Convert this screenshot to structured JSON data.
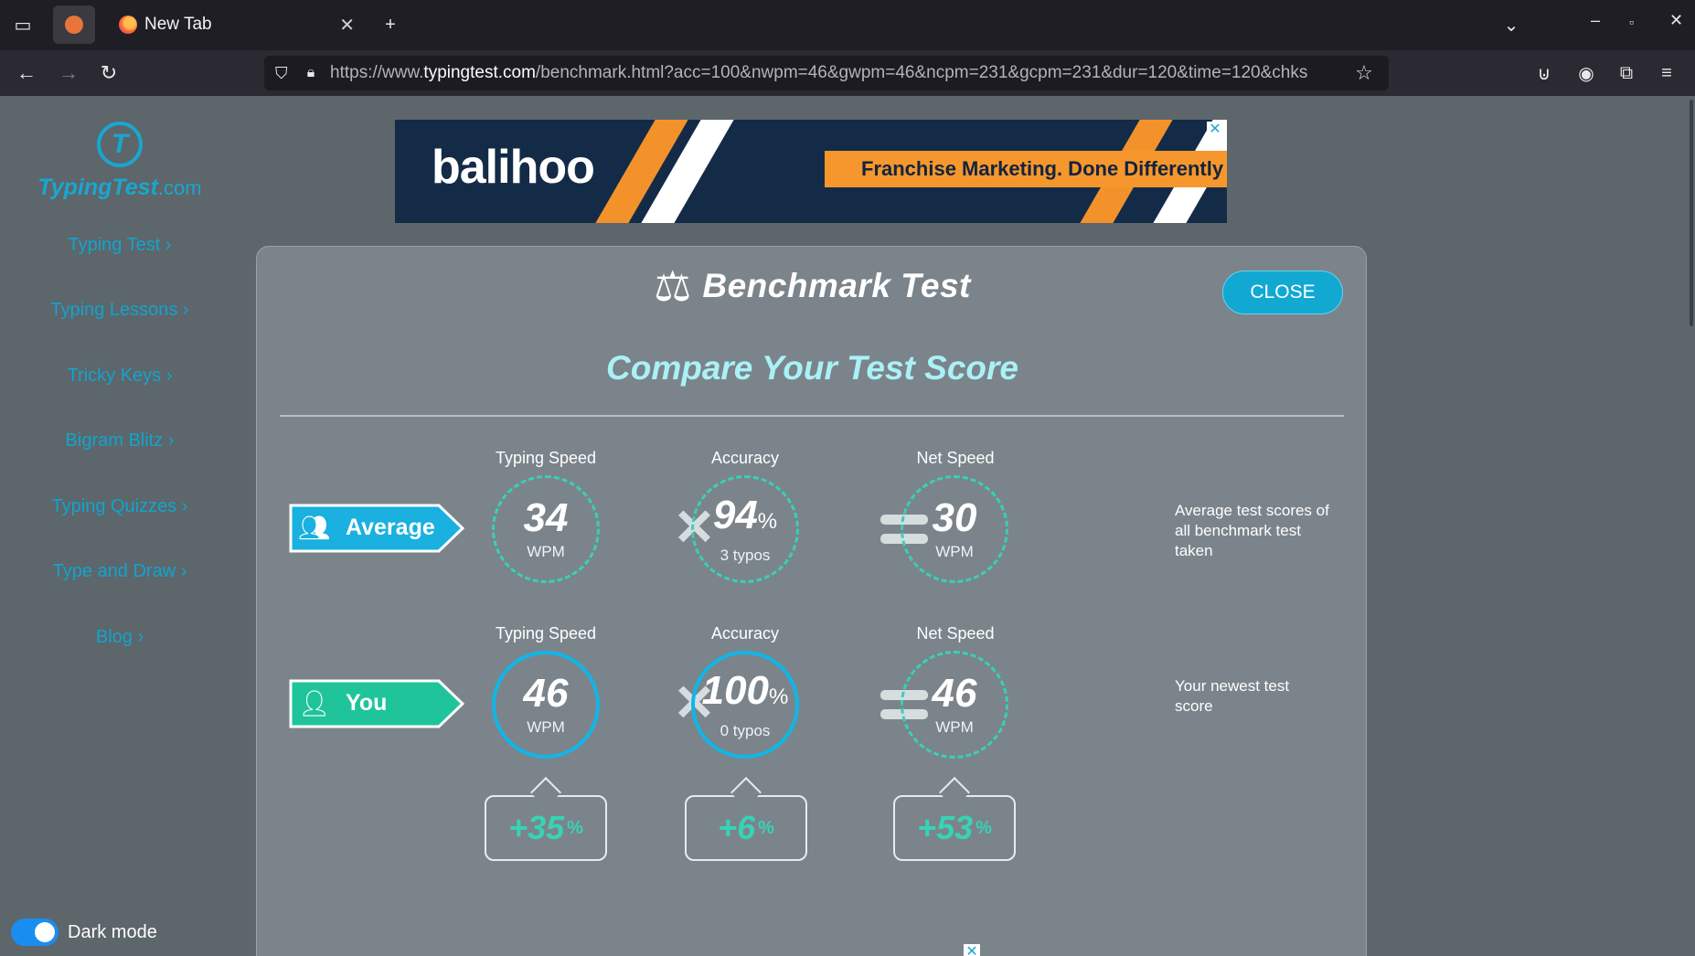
{
  "browser": {
    "tab_title": "New Tab",
    "url_prefix": "https://www.",
    "url_domain": "typingtest.com",
    "url_rest": "/benchmark.html?acc=100&nwpm=46&gwpm=46&ncpm=231&gcpm=231&dur=120&time=120&chks"
  },
  "sidebar": {
    "logo_main": "TypingTest",
    "logo_suffix": ".com",
    "items": [
      {
        "label": "Typing Test ›"
      },
      {
        "label": "Typing Lessons ›"
      },
      {
        "label": "Tricky Keys ›"
      },
      {
        "label": "Bigram Blitz ›"
      },
      {
        "label": "Typing Quizzes ›"
      },
      {
        "label": "Type and Draw ›"
      },
      {
        "label": "Blog ›"
      }
    ],
    "dark_mode_label": "Dark mode"
  },
  "ad": {
    "brand": "balihoo",
    "tagline": "Franchise Marketing. Done Differently",
    "close_glyph": "✕"
  },
  "modal": {
    "title": "Benchmark Test",
    "close_label": "CLOSE",
    "subtitle": "Compare Your Test Score",
    "columns": [
      "Typing Speed",
      "Accuracy",
      "Net Speed"
    ],
    "average": {
      "label": "Average",
      "typing_speed": "34",
      "typing_speed_unit": "WPM",
      "accuracy": "94",
      "accuracy_pct": "%",
      "typos": "3 typos",
      "net_speed": "30",
      "net_speed_unit": "WPM",
      "note": "Average test scores of all benchmark test taken"
    },
    "you": {
      "label": "You",
      "typing_speed": "46",
      "typing_speed_unit": "WPM",
      "accuracy": "100",
      "accuracy_pct": "%",
      "typos": "0 typos",
      "net_speed": "46",
      "net_speed_unit": "WPM",
      "note": "Your newest test score"
    },
    "diffs": [
      {
        "value": "+35",
        "pct": "%"
      },
      {
        "value": "+6",
        "pct": "%"
      },
      {
        "value": "+53",
        "pct": "%"
      }
    ]
  },
  "colors": {
    "accent": "#11a8d2",
    "average_tag": "#1ab0df",
    "you_tag": "#1fc49a",
    "teal_dashed": "#38d0b9",
    "diff_text": "#37d3b6"
  }
}
